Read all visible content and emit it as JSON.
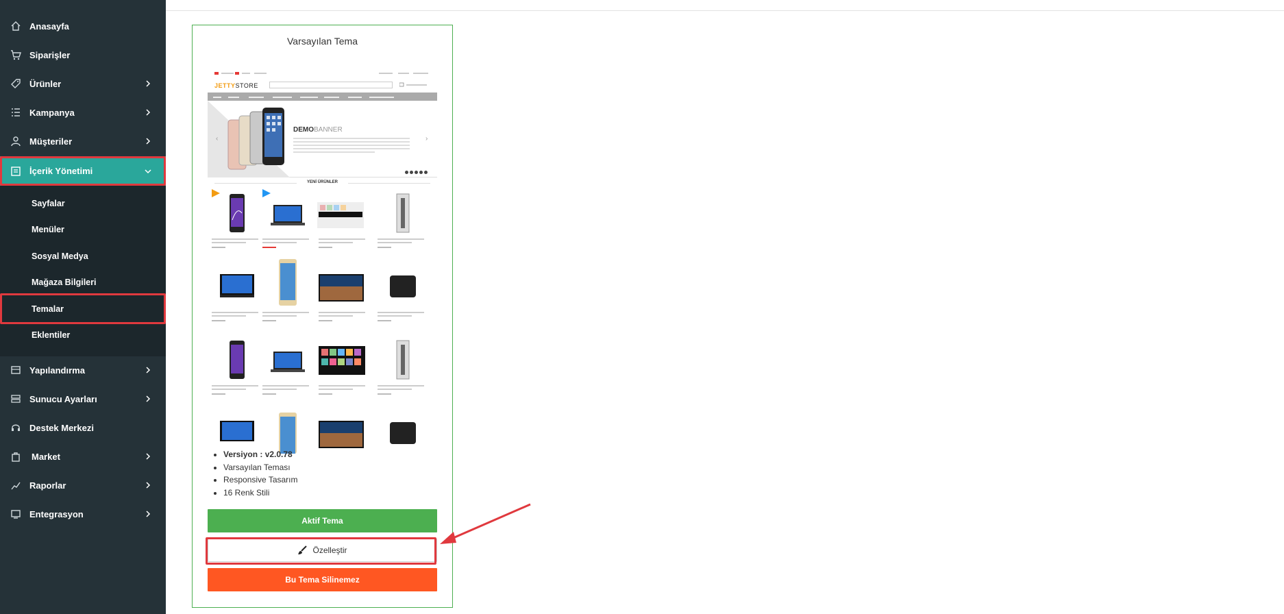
{
  "sidebar": {
    "items": [
      {
        "label": "Anasayfa",
        "icon": "home-icon",
        "chevron": false
      },
      {
        "label": "Siparişler",
        "icon": "cart-icon",
        "chevron": false
      },
      {
        "label": "Ürünler",
        "icon": "tag-icon",
        "chevron": true
      },
      {
        "label": "Kampanya",
        "icon": "list-icon",
        "chevron": true
      },
      {
        "label": "Müşteriler",
        "icon": "user-icon",
        "chevron": true
      },
      {
        "label": "İçerik Yönetimi",
        "icon": "content-icon",
        "chevron": true,
        "active": true
      },
      {
        "label": "Yapılandırma",
        "icon": "config-icon",
        "chevron": true
      },
      {
        "label": "Sunucu Ayarları",
        "icon": "server-icon",
        "chevron": true
      },
      {
        "label": "Destek Merkezi",
        "icon": "headset-icon",
        "chevron": false
      },
      {
        "label": "Market",
        "icon": "bag-icon",
        "chevron": true
      },
      {
        "label": "Raporlar",
        "icon": "chart-icon",
        "chevron": true
      },
      {
        "label": "Entegrasyon",
        "icon": "integration-icon",
        "chevron": true
      }
    ],
    "subitems": [
      {
        "label": "Sayfalar"
      },
      {
        "label": "Menüler"
      },
      {
        "label": "Sosyal Medya"
      },
      {
        "label": "Mağaza Bilgileri"
      },
      {
        "label": "Temalar",
        "selected": true
      },
      {
        "label": "Eklentiler"
      }
    ]
  },
  "theme": {
    "title": "Varsayılan Tema",
    "preview": {
      "logo_main": "JETTY",
      "logo_rest": "STORE",
      "banner_title": "DEMO",
      "banner_title_rest": "BANNER",
      "section_title": "YENİ ÜRÜNLER"
    },
    "details": {
      "version_label": "Versiyon : v2.0.78",
      "line2": "Varsayılan Teması",
      "line3": "Responsive Tasarım",
      "line4": "16 Renk Stili"
    },
    "active_button": "Aktif Tema",
    "customize_button": "Özelleştir",
    "delete_button": "Bu Tema Silinemez"
  },
  "colors": {
    "sidebar_bg": "#253238",
    "active_bg": "#2aa79b",
    "highlight": "#e0393e",
    "green": "#4caf50",
    "orange": "#ff5722"
  }
}
